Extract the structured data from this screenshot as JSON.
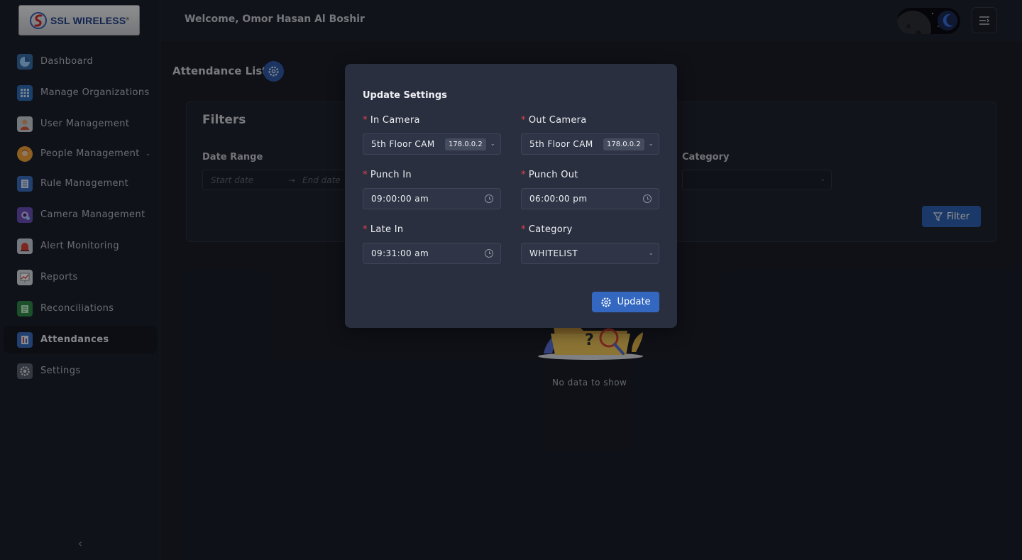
{
  "logo": {
    "text": "SSL WIRELESS",
    "mark": "®"
  },
  "header": {
    "welcome": "Welcome, Omor Hasan Al Boshir"
  },
  "sidebar": {
    "items": [
      {
        "label": "Dashboard",
        "icon": "dashboard-icon"
      },
      {
        "label": "Manage Organizations",
        "icon": "organizations-icon"
      },
      {
        "label": "User Management",
        "icon": "user-icon"
      },
      {
        "label": "People Management",
        "icon": "people-icon",
        "has_submenu": true
      },
      {
        "label": "Rule Management",
        "icon": "rules-icon"
      },
      {
        "label": "Camera Management",
        "icon": "camera-icon"
      },
      {
        "label": "Alert Monitoring",
        "icon": "alert-icon"
      },
      {
        "label": "Reports",
        "icon": "reports-icon"
      },
      {
        "label": "Reconciliations",
        "icon": "reconciliations-icon"
      },
      {
        "label": "Attendances",
        "icon": "attendances-icon",
        "active": true
      },
      {
        "label": "Settings",
        "icon": "settings-icon"
      }
    ]
  },
  "page": {
    "title": "Attendance List",
    "filters_title": "Filters",
    "date_range_label": "Date Range",
    "start_placeholder": "Start date",
    "end_placeholder": "End date",
    "category_label": "Category",
    "filter_button": "Filter",
    "empty_text": "No data to show"
  },
  "modal": {
    "title": "Update Settings",
    "in_camera": {
      "label": "In Camera",
      "value": "5th Floor CAM",
      "tag": "178.0.0.2"
    },
    "out_camera": {
      "label": "Out Camera",
      "value": "5th Floor CAM",
      "tag": "178.0.0.2"
    },
    "punch_in": {
      "label": "Punch In",
      "value": "09:00:00 am"
    },
    "punch_out": {
      "label": "Punch Out",
      "value": "06:00:00 pm"
    },
    "late_in": {
      "label": "Late In",
      "value": "09:31:00 am"
    },
    "category": {
      "label": "Category",
      "value": "WHITELIST"
    },
    "update_button": "Update"
  },
  "colors": {
    "accent": "#3468c0",
    "required": "#e0424e",
    "modal_bg": "#2a2f3f",
    "page_bg": "#1a1e29"
  }
}
